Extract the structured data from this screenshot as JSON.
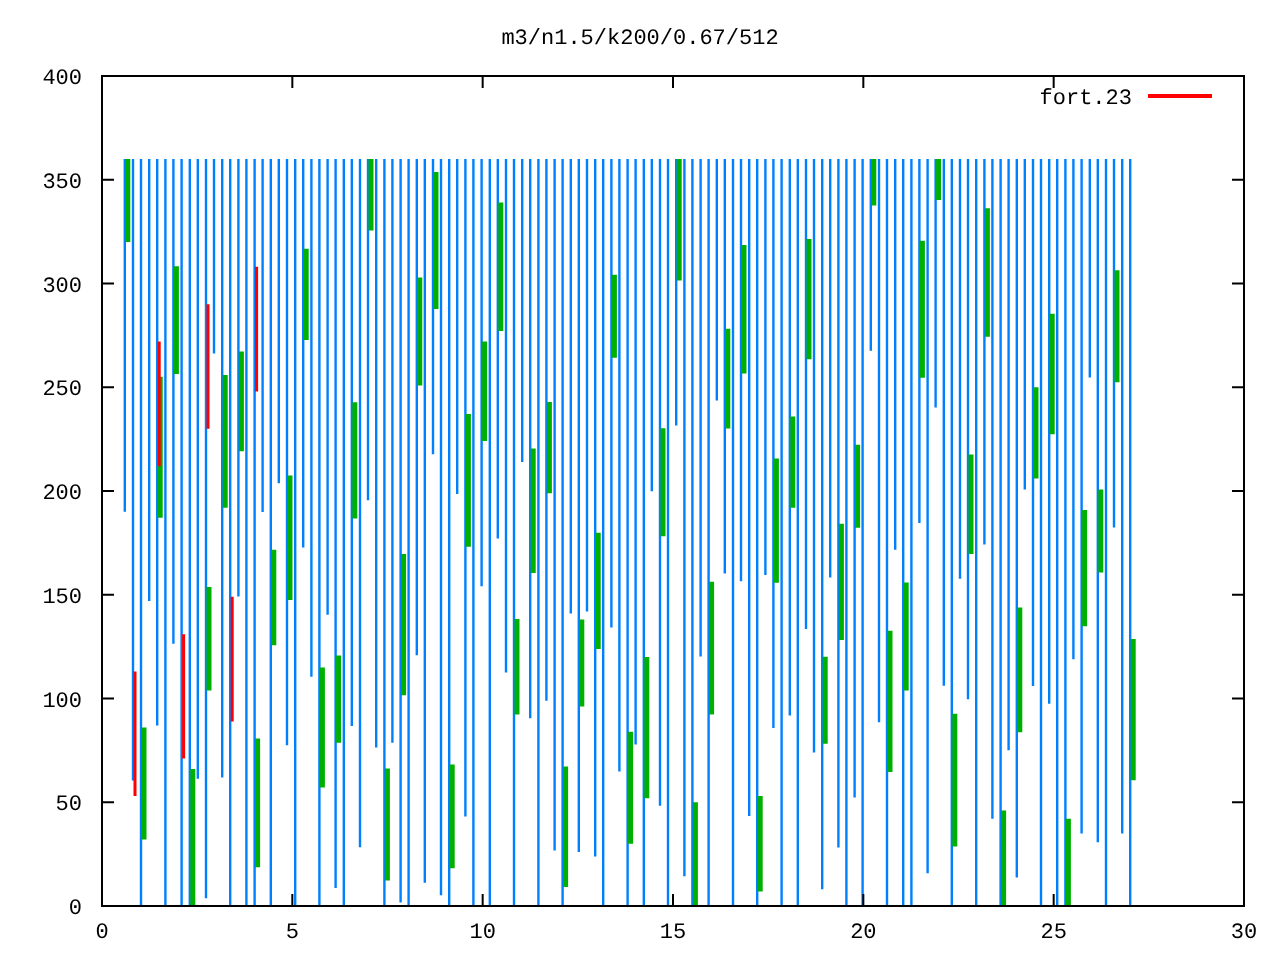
{
  "plot": {
    "title": "m3/n1.5/k200/0.67/512",
    "legend": [
      {
        "label": "fort.23",
        "color": "#ff0000"
      }
    ],
    "x_axis_labels": [
      "0",
      "5",
      "10",
      "15",
      "20",
      "25",
      "30"
    ],
    "y_axis_labels": [
      "400",
      "350",
      "300",
      "250",
      "200",
      "150",
      "100",
      "50",
      "0"
    ]
  }
}
